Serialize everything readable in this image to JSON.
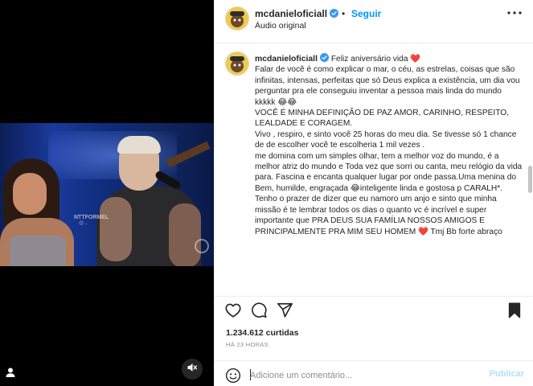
{
  "header": {
    "username": "mcdanieloficiall",
    "separator": "•",
    "follow_label": "Seguir",
    "audio_label": "Áudio original"
  },
  "caption": {
    "username": "mcdanieloficiall",
    "first_line": "Feliz aniversário vida",
    "body": "Falar de você é como explicar o mar, o céu, as estrelas, coisas que são infinitas, intensas, perfeitas que só Deus explica a existência, um dia vou perguntar pra ele conseguiu inventar a pessoa mais linda do mundo kkkkk 😂😂\nVOCÊ É MINHA DEFINIÇÃO DE PAZ AMOR, CARINHO, RESPEITO, LEALDADE E CORAGEM.\nVivo , respiro, e sinto você 25 horas do meu dia. Se tivesse só 1 chance de de escolher você te escolheria 1 mil vezes .\nme domina com um simples olhar, tem a melhor voz do mundo, é a melhor atriz do mundo e Toda vez que sorri ou canta, meu relógio da vida para. Fascina e encanta qualquer lugar por onde passa.Uma menina do\nBem, humilde, engraçada 😂inteligente linda e gostosa p CARALH*.\nTenho o prazer de dizer que eu namoro um anjo e sinto que minha missão é te lembrar todos os dias o quanto vc é incrível e super importante que PRA DEUS SUA FAMÍLIA NOSSOS AMIGOS E PRINCIPALMENTE PRA MIM SEU HOMEM",
    "ending": "Tmj Bb forte abraço",
    "heart": "❤️"
  },
  "video": {
    "watermark": "NTTFORMEL",
    "watermark_sub": "@...",
    "mute_icon": "muted-speaker-icon",
    "user_tag_icon": "user-tag-icon"
  },
  "actions": {
    "like_icon": "heart-icon",
    "comment_icon": "comment-icon",
    "share_icon": "share-icon",
    "save_icon": "bookmark-icon"
  },
  "stats": {
    "likes": "1.234.612 curtidas",
    "time": "HÁ 23 HORAS"
  },
  "comment": {
    "placeholder": "Adicione um comentário...",
    "publish_label": "Publicar"
  },
  "colors": {
    "link": "#0095f6",
    "verified": "#3897f0",
    "heart": "#ed4956",
    "publish_disabled": "#b2dffc"
  }
}
